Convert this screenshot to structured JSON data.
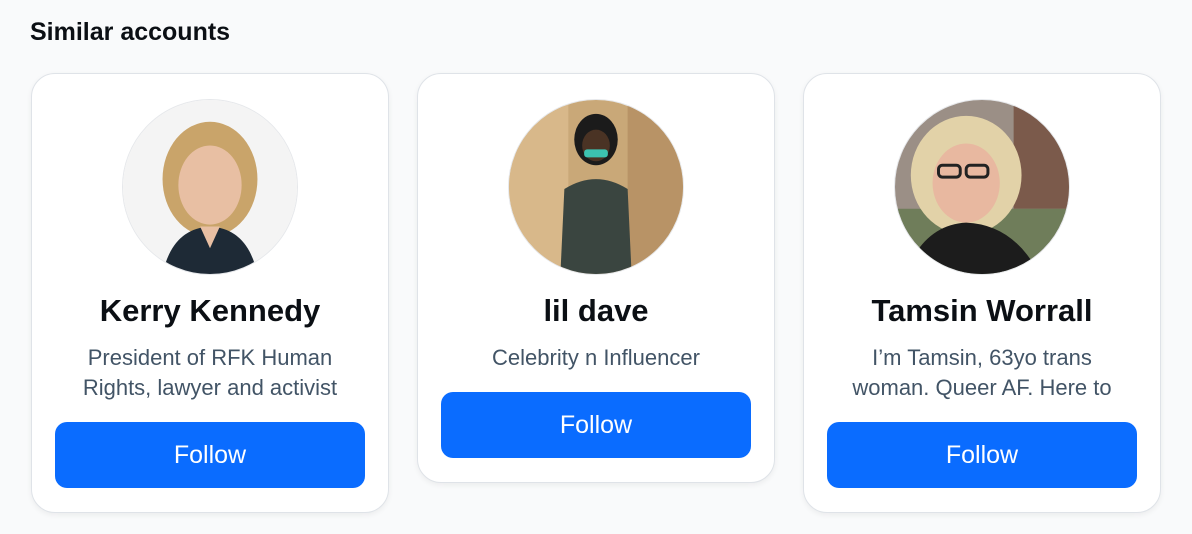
{
  "section": {
    "title": "Similar accounts"
  },
  "accent_color": "#0a6cff",
  "accounts": [
    {
      "name": "Kerry Kennedy",
      "bio": "President of RFK Human Rights, lawyer and activist",
      "follow_label": "Follow"
    },
    {
      "name": "lil dave",
      "bio": "Celebrity n Influencer",
      "follow_label": "Follow"
    },
    {
      "name": "Tamsin Worrall",
      "bio": "I’m Tamsin, 63yo trans woman. Queer AF. Here to",
      "follow_label": "Follow"
    }
  ]
}
